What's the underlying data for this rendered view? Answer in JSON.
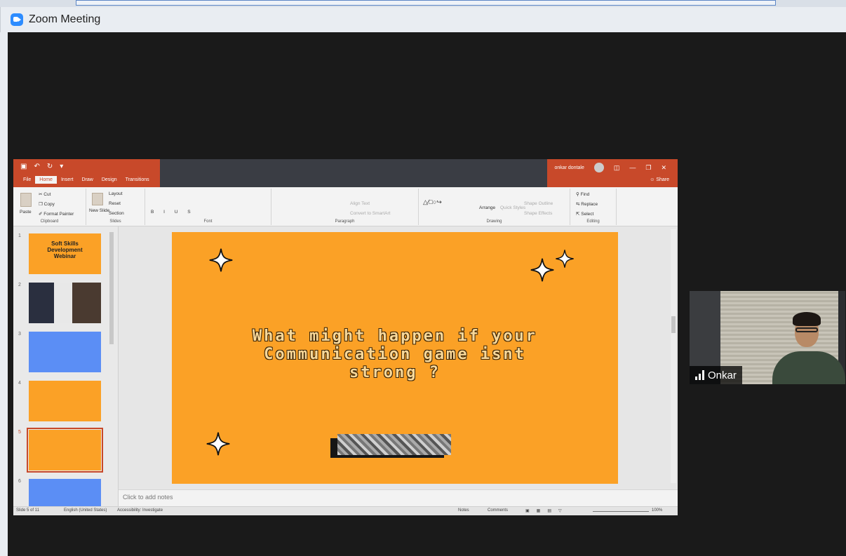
{
  "window": {
    "title": "Zoom Meeting",
    "icon": "zoom-icon"
  },
  "ppt": {
    "tabs": [
      "File",
      "Home",
      "Insert",
      "Draw",
      "Design",
      "Transitions"
    ],
    "active_tab": "Home",
    "user": "onkar dontale",
    "share": "Share",
    "ribbon": {
      "clipboard": {
        "paste": "Paste",
        "cut": "Cut",
        "copy": "Copy",
        "format_painter": "Format Painter",
        "label": "Clipboard"
      },
      "slides": {
        "new_slide": "New Slide",
        "layout": "Layout",
        "reset": "Reset",
        "section": "Section",
        "label": "Slides"
      },
      "font": {
        "label": "Font"
      },
      "paragraph": {
        "align_text": "Align Text",
        "convert": "Convert to SmartArt",
        "label": "Paragraph"
      },
      "drawing": {
        "arrange": "Arrange",
        "quick_styles": "Quick Styles",
        "shape_outline": "Shape Outline",
        "shape_effects": "Shape Effects",
        "label": "Drawing"
      },
      "editing": {
        "find": "Find",
        "replace": "Replace",
        "select": "Select",
        "label": "Editing"
      }
    },
    "thumbnails": [
      {
        "num": "1",
        "text": "Soft Skills Development Webinar",
        "style": "orange"
      },
      {
        "num": "2",
        "text": "",
        "style": "photo"
      },
      {
        "num": "3",
        "text": "",
        "style": "blue"
      },
      {
        "num": "4",
        "text": "",
        "style": "orange"
      },
      {
        "num": "5",
        "text": "",
        "style": "orange",
        "selected": true
      },
      {
        "num": "6",
        "text": "",
        "style": "blue"
      }
    ],
    "slide": {
      "headline_line1": "What might happen if your",
      "headline_line2": "Communication game isnt",
      "headline_line3": "strong ?"
    },
    "notes_placeholder": "Click to add notes",
    "status": {
      "slide": "Slide 5 of 11",
      "language": "English (United States)",
      "accessibility": "Accessibility: Investigate",
      "notes": "Notes",
      "comments": "Comments",
      "zoom": "100%"
    }
  },
  "participant": {
    "name": "Onkar"
  }
}
